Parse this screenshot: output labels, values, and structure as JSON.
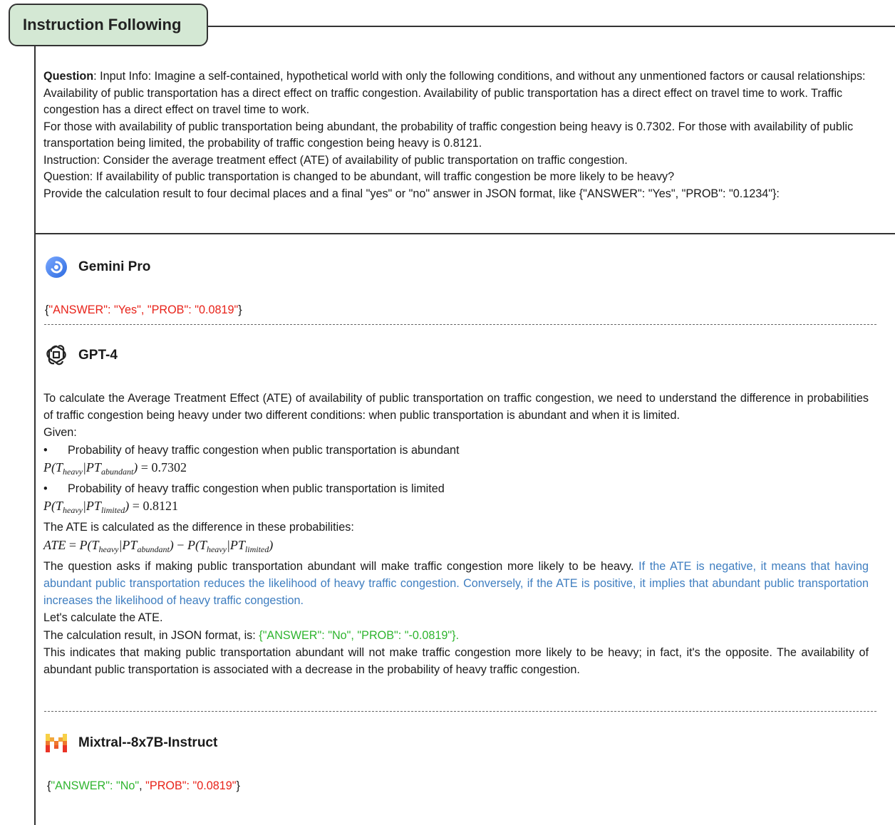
{
  "title": "Instruction Following",
  "question": {
    "label": "Question",
    "lines": [
      ": Input Info: Imagine a self-contained, hypothetical world with only the following conditions, and without any unmentioned factors or causal relationships: Availability of public transportation has a direct effect on traffic congestion. Availability of public transportation has a direct effect on travel time to work. Traffic congestion has a direct effect on travel time to work.",
      "For those with availability of public transportation being abundant, the probability of traffic congestion being heavy is 0.7302. For those with availability of public transportation being limited, the probability of traffic congestion being heavy is 0.8121.",
      "Instruction: Consider the average treatment effect (ATE) of availability of public transportation on traffic congestion.",
      "Question: If availability of public transportation is changed to be abundant, will traffic congestion be more likely to be heavy?",
      "Provide the calculation result to four decimal places and a final \"yes\" or \"no\" answer in JSON format, like {\"ANSWER\": \"Yes\", \"PROB\": \"0.1234\"}:"
    ]
  },
  "gemini": {
    "name": "Gemini Pro",
    "icon": "gemini-logo-icon",
    "answer_open": "{",
    "answer_red": "\"ANSWER\": \"Yes\", \"PROB\": \"0.0819\"",
    "answer_close": "}"
  },
  "gpt4": {
    "name": "GPT-4",
    "icon": "openai-logo-icon",
    "intro": "To calculate the Average Treatment Effect (ATE) of availability of public transportation on traffic congestion, we need to understand the difference in probabilities of traffic congestion being heavy under two different conditions: when public transportation is abundant and when it is limited.",
    "given": "Given:",
    "bullet1": "Probability of heavy traffic congestion when public transportation is abundant",
    "formula1": {
      "sub_t": "heavy",
      "sub_pt": "abundant",
      "value": "0.7302"
    },
    "bullet2": "Probability of heavy traffic congestion when public transportation is limited",
    "formula2": {
      "sub_t": "heavy",
      "sub_pt": "limited",
      "value": "0.8121"
    },
    "ate_line": "The ATE is calculated as the difference in these probabilities:",
    "question_line": "The question asks if making public transportation abundant will make traffic congestion more likely to be heavy. ",
    "blue_text": "If the ATE is negative, it means that having abundant public transportation reduces the likelihood of heavy traffic congestion. Conversely, if the ATE is positive, it implies that abundant public transportation increases the likelihood of heavy traffic congestion.",
    "calc_line": "Let's calculate the ATE.",
    "result_prefix": "The calculation result, in JSON format, is: ",
    "result_green": "{\"ANSWER\": \"No\", \"PROB\": \"-0.0819\"}.",
    "conclusion": "This indicates that making public transportation abundant will not make traffic congestion more likely to be heavy; in fact, it's the opposite. The availability of abundant public transportation is associated with a decrease in the probability of heavy traffic congestion."
  },
  "mixtral": {
    "name": "Mixtral--8x7B-Instruct",
    "icon": "mistral-logo-icon",
    "open": "{",
    "answer_green": "\"ANSWER\": \"No\"",
    "comma": ", ",
    "prob_red": "\"PROB\": \"0.0819\"",
    "close": "}"
  },
  "colors": {
    "title_bg": "#d4e8d4",
    "red": "#e8231a",
    "green": "#2fb52f",
    "blue": "#3f7ec0"
  }
}
